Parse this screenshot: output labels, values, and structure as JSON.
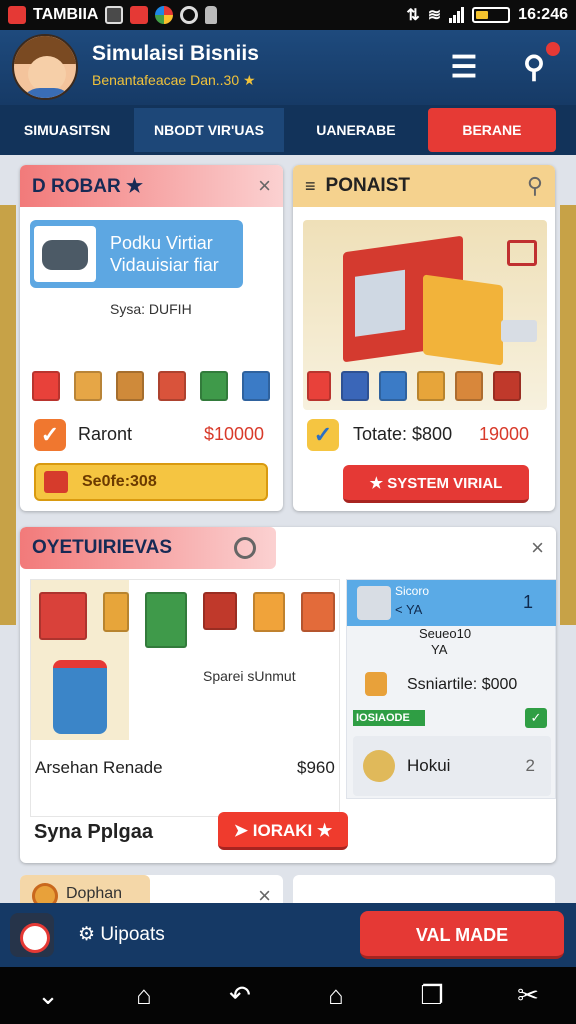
{
  "status": {
    "app": "TAMBIIA",
    "time": "16:246",
    "battery_level": 0.35
  },
  "header": {
    "title": "Simulaisi Bisniis",
    "subtitle": "Benantafeacae Dan..30 ★"
  },
  "tabs": [
    "SIMUASITSN",
    "NBODT VIR'UAS",
    "UANERABE",
    "BERANE"
  ],
  "card_a": {
    "title": "D ROBAR ★",
    "promo": "Podku Virtiar Vidauisiar fiar",
    "caption": "Sysa: DUFIH",
    "row_label": "Raront",
    "row_value": "$10000",
    "button": "Se0fe:308"
  },
  "card_b": {
    "title": "PONAIST",
    "row_label": "Totate: $800",
    "row_value": "19000",
    "button": "SYSTEM VIRIAL"
  },
  "card_c": {
    "title": "OYETUIRIEVAS",
    "label_center": "Sparei sUnmut",
    "item_label": "Arsehan Renade",
    "item_value": "$960",
    "footer_label": "Syna Pplgaa",
    "button": "IORAKI ★",
    "right": {
      "head_line1": "Sicoro",
      "head_line2": "< YA",
      "head_count": "1",
      "sub1": "Seueo10",
      "sub2": "YA",
      "row_label": "Ssniartile: $000",
      "green_tag": "IOSIAODE",
      "bottom_label": "Hokui",
      "bottom_count": "2"
    }
  },
  "peek_left": "Dophan",
  "bottom": {
    "updates": "Uipoats",
    "button": "VAL MADE"
  },
  "colors": {
    "primary": "#153965",
    "accent_red": "#e53935",
    "accent_yellow": "#f5c541"
  }
}
